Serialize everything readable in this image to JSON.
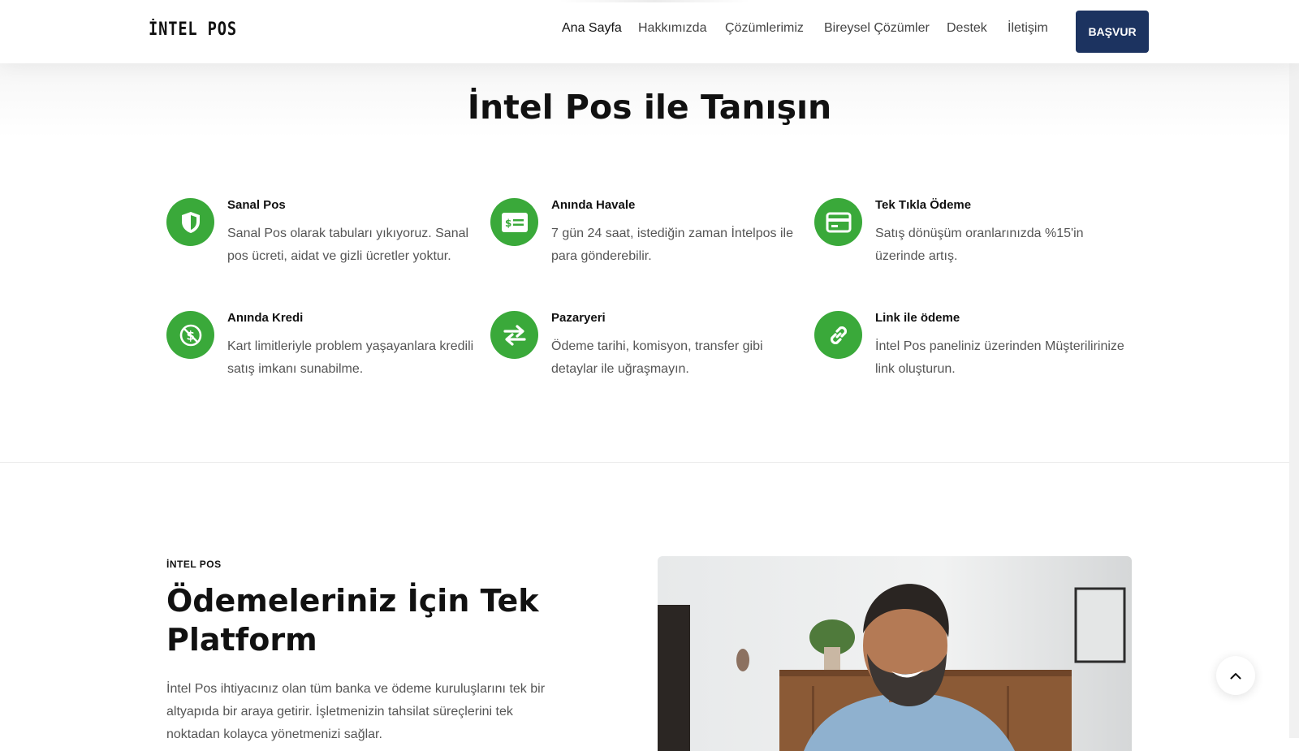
{
  "header": {
    "logo": "İNTEL POS",
    "nav": [
      "Ana Sayfa",
      "Hakkımızda",
      "Çözümlerimiz",
      "Bireysel Çözümler",
      "Destek",
      "İletişim"
    ],
    "apply_label": "BAŞVUR"
  },
  "intro": {
    "title": "İntel Pos ile Tanışın",
    "features": [
      {
        "title": "Sanal Pos",
        "desc": "Sanal Pos olarak tabuları yıkıyoruz. Sanal pos ücreti, aidat ve gizli ücretler yoktur.",
        "icon": "shield-icon"
      },
      {
        "title": "Anında Havale",
        "desc": "7 gün 24 saat, istediğin zaman İntelpos ile para gönderebilir.",
        "icon": "money-transfer-icon"
      },
      {
        "title": "Tek Tıkla Ödeme",
        "desc": "Satış dönüşüm oranlarınızda %15'in üzerinde artış.",
        "icon": "credit-card-icon"
      },
      {
        "title": "Anında Kredi",
        "desc": "Kart limitleriyle problem yaşayanlara kredili satış imkanı sunabilme.",
        "icon": "dollar-circle-icon"
      },
      {
        "title": "Pazaryeri",
        "desc": "Ödeme tarihi, komisyon, transfer gibi detaylar ile uğraşmayın.",
        "icon": "exchange-arrows-icon"
      },
      {
        "title": "Link ile ödeme",
        "desc": "İntel Pos paneliniz üzerinden Müşterilirinize link oluşturun.",
        "icon": "link-icon"
      }
    ]
  },
  "platform": {
    "eyebrow": "İNTEL POS",
    "title": "Ödemeleriniz İçin Tek Platform",
    "text": "İntel Pos ihtiyacınız olan tüm banka ve ödeme kuruluşlarını tek bir altyapıda bir araya getirir. İşletmenizin tahsilat süreçlerini tek noktadan kolayca yönetmenizi sağlar."
  },
  "colors": {
    "accent_green": "#3aa93a",
    "button_navy": "#1c3360"
  }
}
